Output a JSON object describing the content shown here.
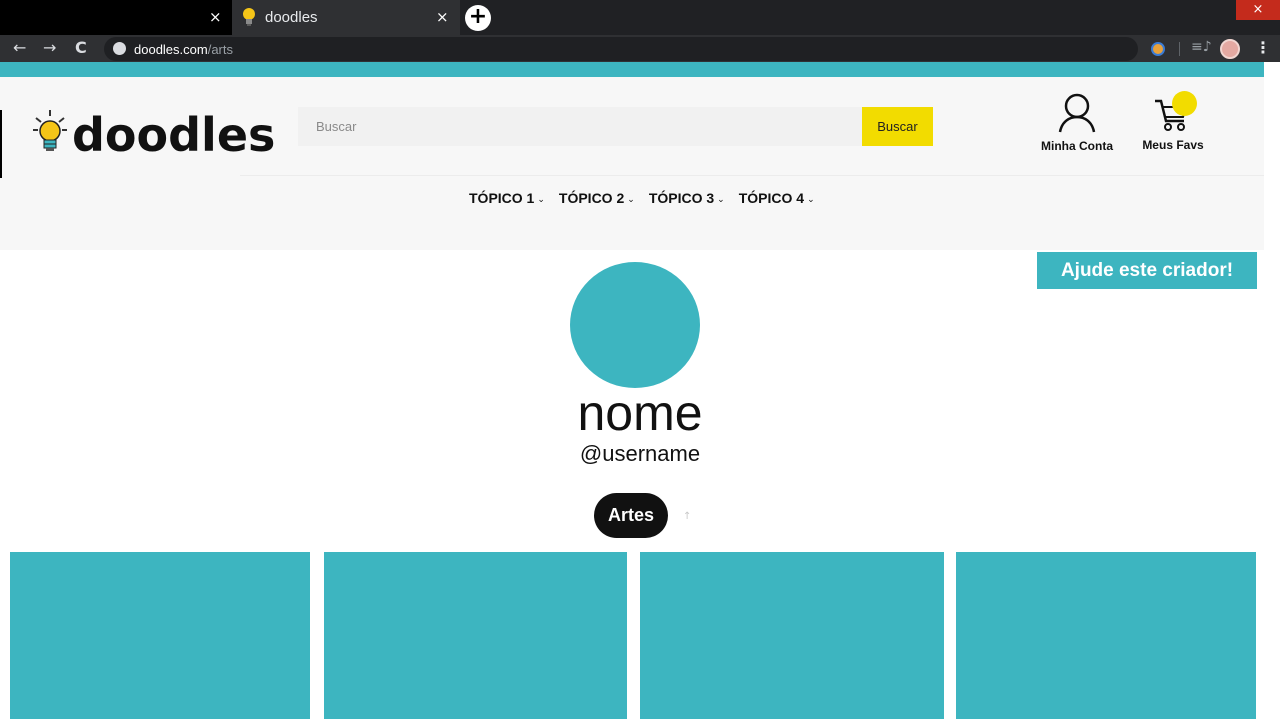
{
  "browser": {
    "prev_tab_close": "×",
    "tab_title": "doodles",
    "tab_close": "×",
    "new_tab": "+",
    "window_close": "×",
    "url_host": "doodles.com",
    "url_path": "/arts",
    "nav": {
      "back": "←",
      "forward": "→",
      "reload": "C"
    },
    "menu": "⋮",
    "queue": "≡♪"
  },
  "site": {
    "logo_text": "doodles",
    "search": {
      "placeholder": "Buscar",
      "button_label": "Buscar"
    },
    "account_label": "Minha Conta",
    "favs_label": "Meus Favs",
    "topics": [
      "TÓPICO 1",
      "TÓPICO 2",
      "TÓPICO 3",
      "TÓPICO 4"
    ],
    "chevron": "⌄"
  },
  "profile": {
    "support_label": "Ajude este criador!",
    "name": "nome",
    "username": "@username",
    "tab_label": "Artes",
    "sort_glyph": "↑"
  },
  "colors": {
    "accent": "#3db5c0",
    "highlight": "#f2dc00",
    "dark": "#111111"
  },
  "gallery": {
    "card_count": 4
  }
}
